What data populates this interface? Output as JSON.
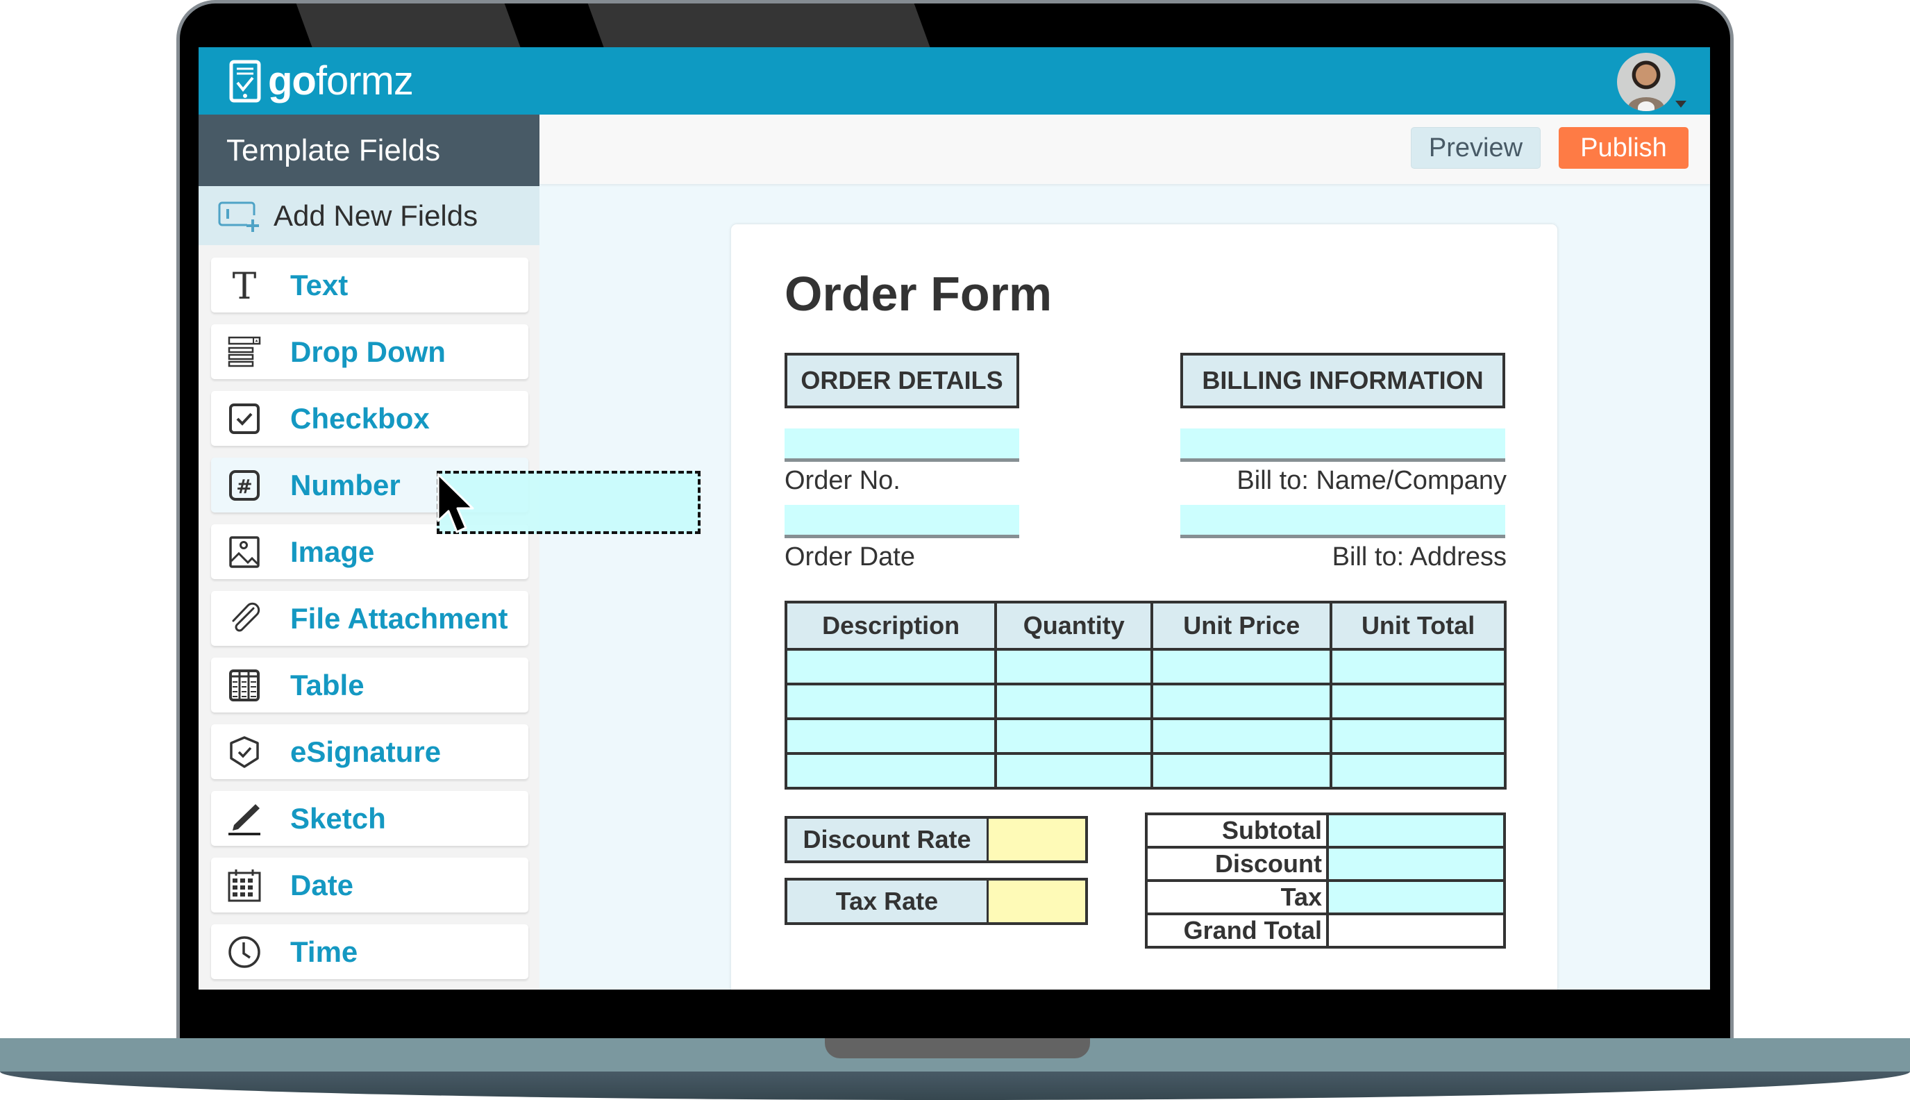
{
  "app": {
    "brand_bold": "go",
    "brand_light": "formz",
    "avatar_alt": "user-avatar"
  },
  "toolbar": {
    "preview_label": "Preview",
    "publish_label": "Publish"
  },
  "sidebar": {
    "title": "Template Fields",
    "add_label": "Add New Fields",
    "items": [
      {
        "label": "Text",
        "icon": "text-icon"
      },
      {
        "label": "Drop Down",
        "icon": "dropdown-icon"
      },
      {
        "label": "Checkbox",
        "icon": "checkbox-icon"
      },
      {
        "label": "Number",
        "icon": "number-icon"
      },
      {
        "label": "Image",
        "icon": "image-icon"
      },
      {
        "label": "File Attachment",
        "icon": "paperclip-icon"
      },
      {
        "label": "Table",
        "icon": "table-icon"
      },
      {
        "label": "eSignature",
        "icon": "shield-check-icon"
      },
      {
        "label": "Sketch",
        "icon": "pencil-icon"
      },
      {
        "label": "Date",
        "icon": "calendar-icon"
      },
      {
        "label": "Time",
        "icon": "clock-icon"
      }
    ],
    "active_item": "Number"
  },
  "form": {
    "title": "Order Form",
    "order_section": "ORDER DETAILS",
    "billing_section": "BILLING INFORMATION",
    "order_no_label": "Order No.",
    "order_date_label": "Order Date",
    "bill_name_label": "Bill to: Name/Company",
    "bill_address_label": "Bill to: Address",
    "table_headers": [
      "Description",
      "Quantity",
      "Unit Price",
      "Unit Total"
    ],
    "table_rows": 4,
    "discount_rate_label": "Discount Rate",
    "tax_rate_label": "Tax Rate",
    "totals": [
      "Subtotal",
      "Discount",
      "Tax",
      "Grand Total"
    ]
  },
  "colors": {
    "brand": "#0e9ac2",
    "sidebar_header": "#485a66",
    "accent_orange": "#fe7b45",
    "field_fill": "#ccfefe",
    "rate_fill": "#fefab7",
    "label_blue": "#1498c2"
  }
}
